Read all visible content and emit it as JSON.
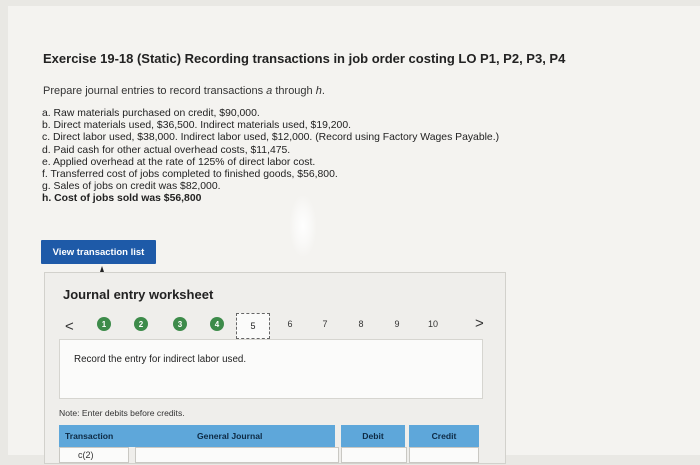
{
  "title": "Exercise 19-18 (Static) Recording transactions in job order costing LO P1, P2, P3, P4",
  "instructions": {
    "prefix": "Prepare journal entries to record transactions ",
    "emph": "a",
    "middle": " through ",
    "emph2": "h",
    "suffix": "."
  },
  "transactions": [
    "a. Raw materials purchased on credit, $90,000.",
    "b. Direct materials used, $36,500. Indirect materials used, $19,200.",
    "c. Direct labor used, $38,000. Indirect labor used, $12,000. (Record using Factory Wages Payable.)",
    "d. Paid cash for other actual overhead costs, $11,475.",
    "e. Applied overhead at the rate of 125% of direct labor cost.",
    "f. Transferred cost of jobs completed to finished goods, $56,800.",
    "g. Sales of jobs on credit was $82,000.",
    "h. Cost of jobs sold was $56,800"
  ],
  "view_button": "View transaction list",
  "worksheet": {
    "title": "Journal entry worksheet",
    "prev": "<",
    "next": ">",
    "steps": [
      "1",
      "2",
      "3",
      "4",
      "5",
      "6",
      "7",
      "8",
      "9",
      "10"
    ],
    "record_text": "Record the entry for indirect labor used.",
    "note": "Note: Enter debits before credits.",
    "columns": [
      "Transaction",
      "General Journal",
      "Debit",
      "Credit"
    ],
    "row": {
      "transaction": "c(2)"
    }
  }
}
